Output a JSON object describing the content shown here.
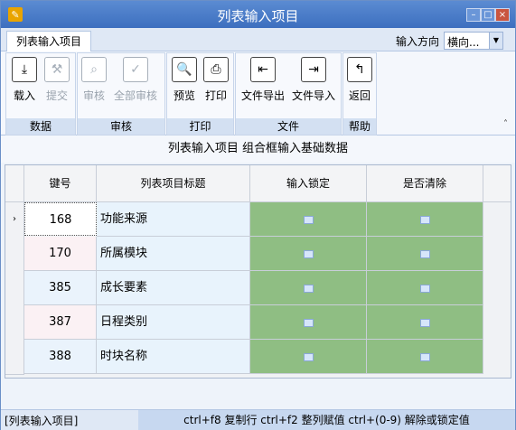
{
  "window": {
    "title": "列表输入项目"
  },
  "tabs": [
    {
      "label": "列表输入项目"
    }
  ],
  "direction": {
    "label": "输入方向",
    "value": "横向..."
  },
  "ribbon": {
    "groups": [
      {
        "title": "数据",
        "buttons": [
          {
            "label": "载入",
            "icon": "download-icon",
            "enabled": true
          },
          {
            "label": "提交",
            "icon": "gavel-icon",
            "enabled": false
          }
        ]
      },
      {
        "title": "审核",
        "buttons": [
          {
            "label": "审核",
            "icon": "magnifier-icon",
            "enabled": false
          },
          {
            "label": "全部审核",
            "icon": "check-all-icon",
            "enabled": false
          }
        ]
      },
      {
        "title": "打印",
        "buttons": [
          {
            "label": "预览",
            "icon": "preview-icon",
            "enabled": true
          },
          {
            "label": "打印",
            "icon": "printer-icon",
            "enabled": true
          }
        ]
      },
      {
        "title": "文件",
        "buttons": [
          {
            "label": "文件导出",
            "icon": "export-icon",
            "enabled": true
          },
          {
            "label": "文件导入",
            "icon": "import-icon",
            "enabled": true
          }
        ]
      },
      {
        "title": "帮助",
        "buttons": [
          {
            "label": "返回",
            "icon": "back-icon",
            "enabled": true
          }
        ]
      }
    ]
  },
  "caption": "列表输入项目 组合框输入基础数据",
  "table": {
    "columns": [
      "键号",
      "列表项目标题",
      "输入锁定",
      "是否清除"
    ],
    "rows": [
      {
        "key": "168",
        "title": "功能来源"
      },
      {
        "key": "170",
        "title": "所属模块"
      },
      {
        "key": "385",
        "title": "成长要素"
      },
      {
        "key": "387",
        "title": "日程类别"
      },
      {
        "key": "388",
        "title": "时块名称"
      }
    ]
  },
  "status": {
    "left": "[列表输入项目]",
    "right": "ctrl+f8 复制行 ctrl+f2 整列赋值 ctrl+(0-9) 解除或锁定值"
  },
  "colors": {
    "title_bar": "#3d6fbf",
    "check_col": "#8fbe83",
    "title_col": "#e8f3fc"
  }
}
